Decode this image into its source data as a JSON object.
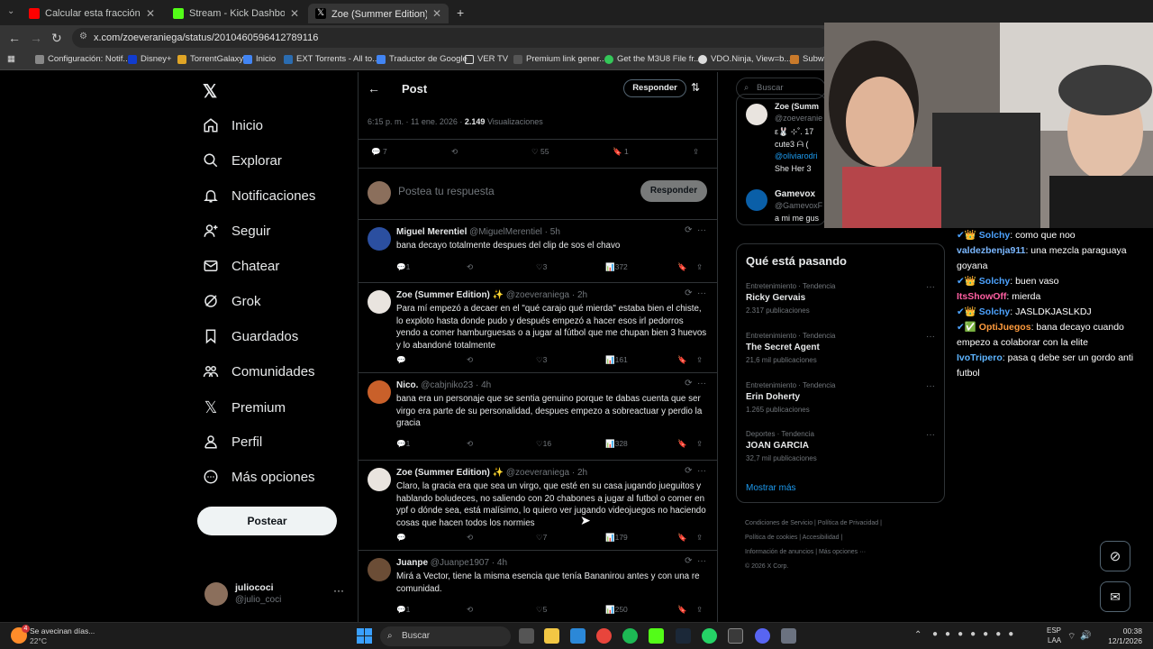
{
  "browser": {
    "tabs": [
      {
        "label": "Calcular esta fracción con pote",
        "color": "#ff0000"
      },
      {
        "label": "Stream - Kick Dashboard",
        "color": "#53fc18"
      },
      {
        "label": "Zoe (Summer Edition) ✨ en X",
        "color": "#ffffff"
      }
    ],
    "url": "x.com/zoeveraniega/status/2010460596412789116",
    "bookmarks": [
      "Configuración: Notif...",
      "Disney+",
      "TorrentGalaxy",
      "Inicio",
      "EXT Torrents - All to...",
      "Traductor de Google",
      "VER TV",
      "Premium link gener...",
      "Get the M3U8 File fr...",
      "VDO.Ninja, View=b...",
      "Subwa"
    ]
  },
  "leftnav": {
    "items": [
      "Inicio",
      "Explorar",
      "Notificaciones",
      "Seguir",
      "Chatear",
      "Grok",
      "Guardados",
      "Comunidades",
      "Premium",
      "Perfil",
      "Más opciones"
    ],
    "post_button": "Postear",
    "user_name": "juliococi",
    "user_handle": "@julio_coci"
  },
  "post": {
    "header_title": "Post",
    "subscribe_label": "Responder",
    "meta_time": "6:15 p. m. · 11 ene. 2026 · ",
    "meta_views": "2.149",
    "meta_views_label": " Visualizaciones",
    "replies": "7",
    "likes": "55",
    "bookmarks": "1",
    "reply_placeholder": "Postea tu respuesta",
    "reply_button": "Responder"
  },
  "replies": [
    {
      "name": "Miguel Merentiel",
      "handle": "@MiguelMerentiel · 5h",
      "text": "bana decayo totalmente despues del clip de sos el chavo",
      "replies": "1",
      "likes": "3",
      "views": "372"
    },
    {
      "name": "Zoe (Summer Edition) ✨",
      "handle": "@zoeveraniega · 2h",
      "text": "Para mí empezó a decaer en el \"qué carajo qué mierda\" estaba bien el chiste, lo exploto hasta donde pudo y después empezó a hacer esos irl pedorros yendo a comer hamburguesas o a jugar al fútbol que me chupan bien 3 huevos y lo abandoné totalmente",
      "replies": "",
      "likes": "3",
      "views": "161"
    },
    {
      "name": "Nico.",
      "handle": "@cabjniko23 · 4h",
      "text": "bana era un personaje que se sentia genuino porque te dabas cuenta que ser virgo era parte de su personalidad, despues empezo a sobreactuar y perdio la gracia",
      "replies": "1",
      "likes": "16",
      "views": "328"
    },
    {
      "name": "Zoe (Summer Edition) ✨",
      "handle": "@zoeveraniega · 2h",
      "text": "Claro, la gracia era que sea un virgo, que esté en su casa jugando jueguitos y hablando boludeces, no saliendo con 20 chabones a jugar al futbol o comer en ypf o dónde sea, está malísimo, lo quiero ver jugando videojuegos no haciendo cosas que hacen todos los normies",
      "replies": "",
      "likes": "7",
      "views": "179"
    },
    {
      "name": "Juanpe",
      "handle": "@Juanpe1907 · 4h",
      "text": "Mirá a Vector, tiene la misma esencia que tenía Bananirou antes y con una re comunidad.",
      "replies": "1",
      "likes": "5",
      "views": "250"
    }
  ],
  "rightcol": {
    "search_placeholder": "Buscar",
    "partial_user_1": "Zoe (Summ",
    "partial_handle_1": "@zoeveranie",
    "partial_text_1a": "ε🐰 ⊹˚. 17",
    "partial_text_1b": "cute3 ᗩ (",
    "partial_text_1c": "@oliviarodri",
    "partial_text_1d": "She   Her 3",
    "partial_user_2": "Gamevox",
    "partial_handle_2": "@GamevoxF",
    "partial_text_2": "a mi me gus",
    "trending_title": "Qué está pasando",
    "trends": [
      {
        "category": "Entretenimiento · Tendencia",
        "name": "Ricky Gervais",
        "count": "2.317 publicaciones"
      },
      {
        "category": "Entretenimiento · Tendencia",
        "name": "The Secret Agent",
        "count": "21,6 mil publicaciones"
      },
      {
        "category": "Entretenimiento · Tendencia",
        "name": "Erin Doherty",
        "count": "1.265 publicaciones"
      },
      {
        "category": "Deportes · Tendencia",
        "name": "JOAN GARCIA",
        "count": "32,7 mil publicaciones"
      }
    ],
    "show_more": "Mostrar más",
    "footer_1": "Condiciones de Servicio  |  Política de Privacidad  |",
    "footer_2": "Política de cookies  |  Accesibilidad  |",
    "footer_3": "Información de anuncios  |  Más opciones ···",
    "footer_4": "© 2026 X Corp."
  },
  "chat": [
    {
      "user": "Solchy",
      "color": "#4da3ff",
      "msg": ": como que noo"
    },
    {
      "user": "valdezbenja911",
      "color": "#7ab7ff",
      "msg": ": una mezcla paraguaya goyana"
    },
    {
      "user": "Solchy",
      "color": "#4da3ff",
      "msg": ": buen vaso"
    },
    {
      "user": "ItsShowOff",
      "color": "#ff5fa2",
      "msg": ":    mierda"
    },
    {
      "user": "Solchy",
      "color": "#4da3ff",
      "msg": ": JASLDKJASLKDJ"
    },
    {
      "user": "OptiJuegos",
      "color": "#ff9b3d",
      "msg": ": bana decayo cuando empezo a colaborar con la elite"
    },
    {
      "user": "IvoTripero",
      "color": "#5db4ff",
      "msg": ": pasa q debe ser un gordo anti futbol"
    }
  ],
  "taskbar": {
    "weather_text": "Se avecinan días...",
    "weather_temp": "22°C",
    "search_placeholder": "Buscar",
    "lang": "ESP",
    "lang2": "LAA",
    "time": "00:38",
    "date": "12/1/2026",
    "badge": "4"
  }
}
